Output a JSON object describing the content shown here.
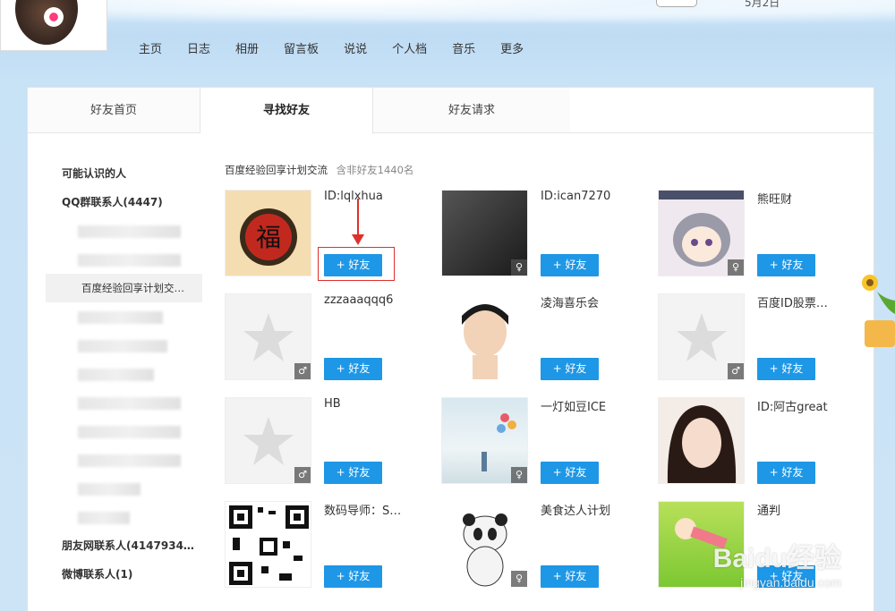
{
  "header": {
    "date_fragment": "5月2日"
  },
  "main_nav": [
    "主页",
    "日志",
    "相册",
    "留言板",
    "说说",
    "个人档",
    "音乐",
    "更多"
  ],
  "tabs": [
    {
      "label": "好友首页",
      "active": false
    },
    {
      "label": "寻找好友",
      "active": true
    },
    {
      "label": "好友请求",
      "active": false
    }
  ],
  "sidebar": {
    "heading1": "可能认识的人",
    "heading2": "QQ群联系人(4447)",
    "selected_group": "百度经验回享计划交…",
    "heading3": "朋友网联系人(4147934…",
    "heading4": "微博联系人(1)"
  },
  "content": {
    "group_name": "百度经验回享计划交流",
    "group_meta": "含非好友1440名",
    "add_label": "+ 好友",
    "friends": [
      {
        "name": "ID:lqlxhua",
        "gender": ""
      },
      {
        "name": "ID:ican7270",
        "gender": "♀"
      },
      {
        "name": "熊旺财",
        "gender": "♀"
      },
      {
        "name": "zzzaaaqqq6",
        "gender": "♂"
      },
      {
        "name": "凌海喜乐会",
        "gender": ""
      },
      {
        "name": "百度ID股票…",
        "gender": "♂"
      },
      {
        "name": "HB",
        "gender": "♂"
      },
      {
        "name": "一灯如豆ICE",
        "gender": "♀"
      },
      {
        "name": "ID:阿古great",
        "gender": ""
      },
      {
        "name": "数码导师：S…",
        "gender": ""
      },
      {
        "name": "美食达人计划",
        "gender": "♀"
      },
      {
        "name": "通判",
        "gender": ""
      }
    ]
  },
  "watermark": {
    "main": "Baidu经验",
    "sub": "jingyan.baidu.com"
  },
  "colors": {
    "accent": "#1e97e6",
    "highlight": "#e0302c"
  }
}
